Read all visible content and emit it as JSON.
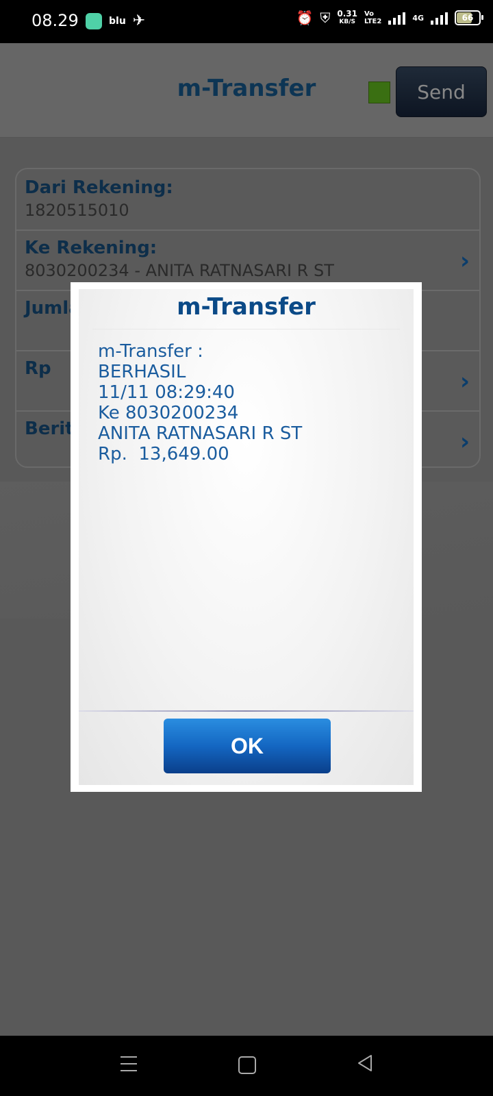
{
  "status_bar": {
    "time": "08.29",
    "carrier_text": "blu",
    "net_speed_value": "0.31",
    "net_speed_unit": "KB/S",
    "volte_line1": "Vo",
    "volte_line2": "LTE2",
    "network_type": "4G",
    "battery_level": "66"
  },
  "header": {
    "title": "m-Transfer",
    "send_label": "Send"
  },
  "form": {
    "rows": [
      {
        "label": "Dari Rekening:",
        "value": "1820515010"
      },
      {
        "label": "Ke Rekening:",
        "value": "8030200234 - ANITA RATNASARI R ST"
      },
      {
        "label": "Jumlah",
        "value": ""
      },
      {
        "label": "Rp",
        "value": ""
      },
      {
        "label": "Berita",
        "value": ""
      }
    ]
  },
  "dialog": {
    "title": "m-Transfer",
    "lines": [
      "m-Transfer :",
      "BERHASIL",
      "11/11 08:29:40",
      "Ke 8030200234",
      "ANITA RATNASARI R ST",
      "Rp.  13,649.00"
    ],
    "ok_label": "OK"
  },
  "colors": {
    "accent_blue": "#1467c2",
    "status_green": "#3a6f12"
  }
}
